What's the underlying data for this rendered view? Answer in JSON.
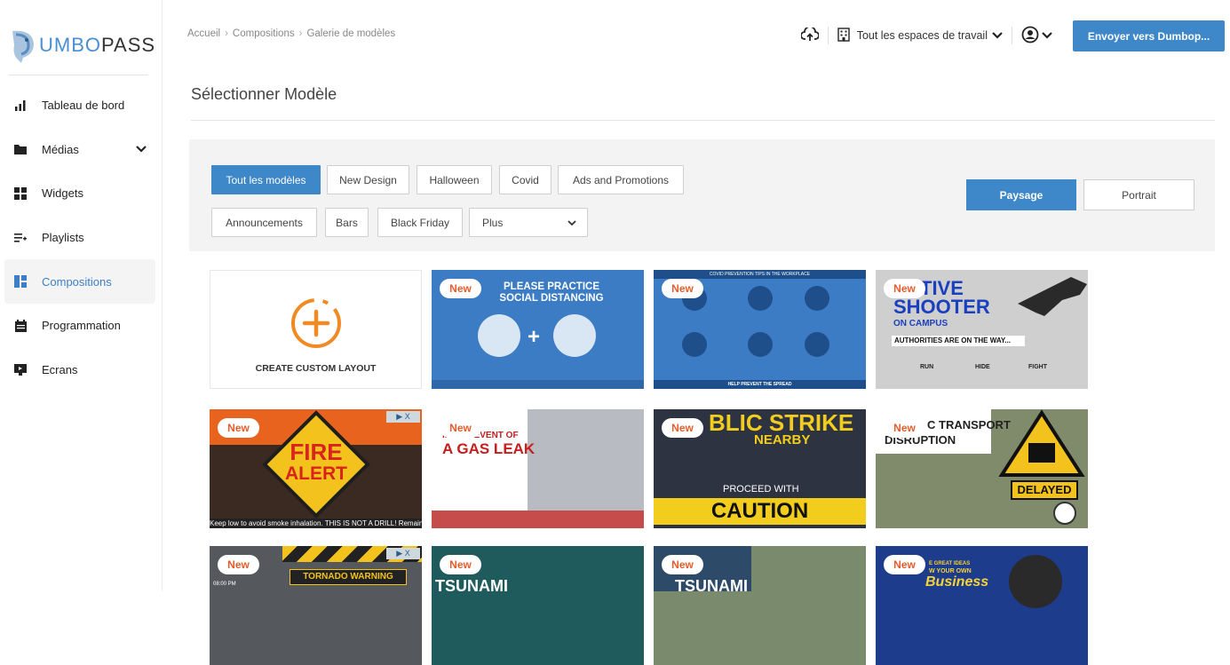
{
  "brand": {
    "part1": "UMBO",
    "part2": "PASS"
  },
  "sidebar": {
    "items": [
      {
        "label": "Tableau de bord",
        "icon": "bar-chart-icon"
      },
      {
        "label": "Médias",
        "icon": "folder-icon"
      },
      {
        "label": "Widgets",
        "icon": "grid-icon"
      },
      {
        "label": "Playlists",
        "icon": "playlist-icon"
      },
      {
        "label": "Compositions",
        "icon": "layout-icon"
      },
      {
        "label": "Programmation",
        "icon": "calendar-icon"
      },
      {
        "label": "Ecrans",
        "icon": "monitor-icon"
      }
    ]
  },
  "header": {
    "breadcrumb": [
      "Accueil",
      "Compositions",
      "Galerie de modèles"
    ],
    "workspace": "Tout les espaces de travail",
    "send_button": "Envoyer vers Dumbop..."
  },
  "page": {
    "title": "Sélectionner Modèle"
  },
  "filters": {
    "chips": [
      "Tout les modèles",
      "New Design",
      "Halloween",
      "Covid",
      "Ads and Promotions",
      "Announcements",
      "Bars",
      "Black Friday"
    ],
    "more_select": "Plus",
    "orientation": {
      "landscape": "Paysage",
      "portrait": "Portrait"
    }
  },
  "templates": {
    "badge": "New",
    "create_label": "CREATE CUSTOM LAYOUT",
    "social": {
      "line1": "PLEASE PRACTICE",
      "line2": "SOCIAL DISTANCING"
    },
    "covid": {
      "top": "COVID PREVENTION TIPS IN THE WORKPLACE",
      "bottom": "HELP PREVENT THE SPREAD"
    },
    "shooter": {
      "title1": "TIVE",
      "title2": "SHOOTER",
      "sub": "ON CAMPUS",
      "auth": "AUTHORITIES ARE ON THE WAY...",
      "run": "RUN",
      "hide": "HIDE",
      "fight": "FIGHT"
    },
    "fire": {
      "line1": "FIRE",
      "line2": "ALERT",
      "ticker": "Keep low to avoid smoke inhalation. THIS IS NOT A DRILL! Remain"
    },
    "gas": {
      "line1": "IN THE EVENT OF",
      "line2": "A GAS LEAK"
    },
    "strike": {
      "title": "BLIC STRIKE",
      "sub": "NEARBY",
      "proceed": "PROCEED WITH",
      "caution": "CAUTION"
    },
    "transport": {
      "title": "C TRANSPORT",
      "sub": "DISRUPTION",
      "delayed": "DELAYED"
    },
    "tornado": {
      "label": "TORNADO WARNING",
      "time": "08:00 PM"
    },
    "tsunami": "TSUNAMI",
    "business": {
      "top": "E GREAT IDEAS",
      "mid": "W YOUR OWN",
      "word": "Business"
    }
  }
}
